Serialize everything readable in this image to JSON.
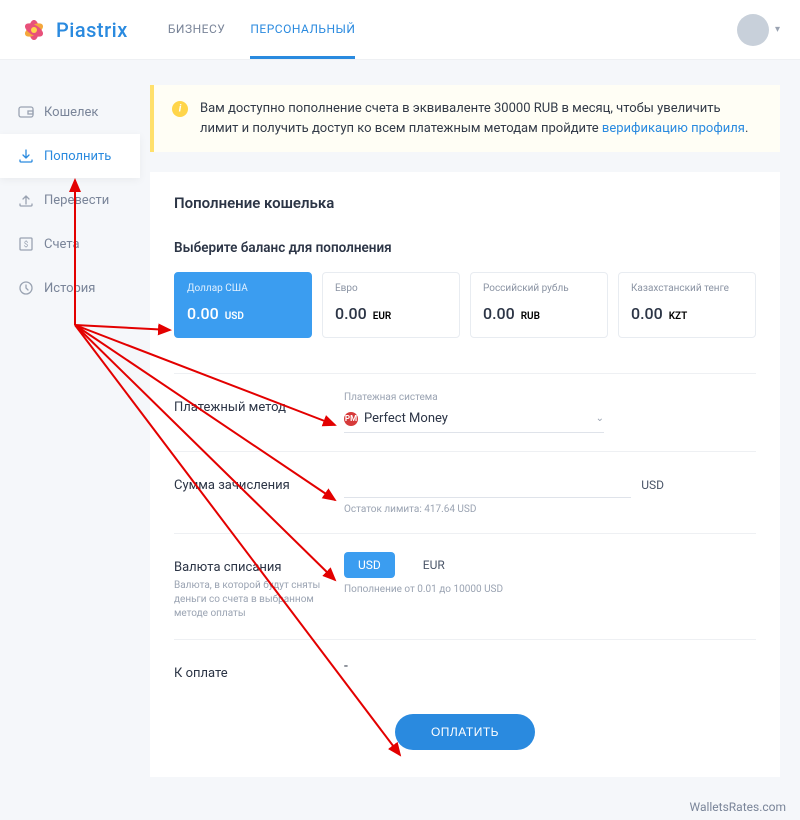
{
  "brand": "Piastrix",
  "tabs": {
    "business": "БИЗНЕСУ",
    "personal": "ПЕРСОНАЛЬНЫЙ"
  },
  "sidebar": {
    "wallet": "Кошелек",
    "topup": "Пополнить",
    "transfer": "Перевести",
    "accounts": "Счета",
    "history": "История"
  },
  "notice": {
    "pre": "Вам доступно пополнение счета в эквиваленте 30000 RUB в месяц, чтобы увеличить лимит и получить доступ ко всем платежным методам пройдите ",
    "link": "верификацию профиля",
    "post": "."
  },
  "panel": {
    "title": "Пополнение кошелька",
    "choose": "Выберите баланс для пополнения"
  },
  "balances": [
    {
      "name": "Доллар США",
      "value": "0.00",
      "cur": "USD"
    },
    {
      "name": "Евро",
      "value": "0.00",
      "cur": "EUR"
    },
    {
      "name": "Российский рубль",
      "value": "0.00",
      "cur": "RUB"
    },
    {
      "name": "Казахстанский тенге",
      "value": "0.00",
      "cur": "KZT"
    }
  ],
  "method": {
    "label": "Платежный метод",
    "small": "Платежная система",
    "value": "Perfect Money"
  },
  "amount": {
    "label": "Сумма зачисления",
    "unit": "USD",
    "hint": "Остаток лимита: 417.64 USD"
  },
  "debit": {
    "label": "Валюта списания",
    "sub": "Валюта, в которой будут сняты деньги со счета в выбранном методе оплаты",
    "usd": "USD",
    "eur": "EUR",
    "hint": "Пополнение от 0.01 до 10000 USD"
  },
  "topay": {
    "label": "К оплате",
    "value": "-"
  },
  "pay": "ОПЛАТИТЬ",
  "watermark": "WalletsRates.com"
}
